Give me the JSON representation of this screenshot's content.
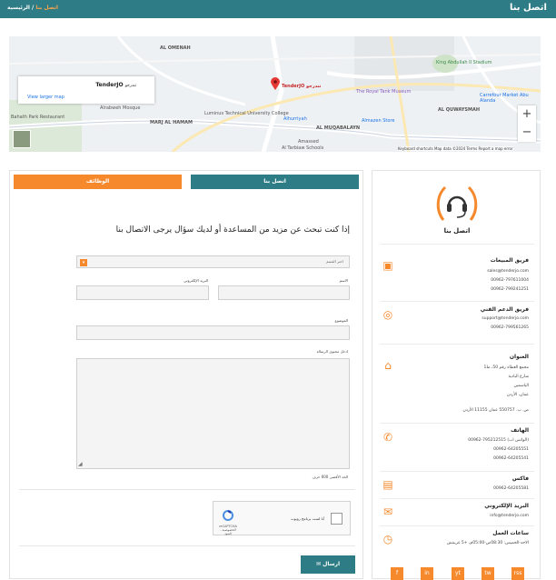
{
  "header": {
    "title": "اتصل بنا",
    "breadcrumb_home": "الرئيسية",
    "breadcrumb_sep": "/",
    "breadcrumb_current": "اتصل بنا"
  },
  "map": {
    "place_title": "TenderJO",
    "place_sub": "تندرجو",
    "larger_map": "View larger map",
    "marker_label": "TenderJO تندرجو",
    "labels": [
      "Luminus Technical University College",
      "Alrabweh Mosque",
      "MARJ AL HAMAM",
      "Bahath Park Restaurant",
      "AL OMENAH",
      "The Royal Tank Museum",
      "King Abdullah II Stadium",
      "Carrefour Market Abu Alanda",
      "AL QUWAYSMAH",
      "Almazen Store",
      "AL MUQABALAYN",
      "Al Tarbiaw Schools",
      "Alhurriyah",
      "Amassed"
    ],
    "google": "Google",
    "footer": "Keyboard shortcuts   Map data ©2024   Terms   Report a map error",
    "zoom_in": "+",
    "zoom_out": "−"
  },
  "tabs": {
    "contact": "اتصل بنا",
    "jobs": "الوظائف"
  },
  "form": {
    "intro": "إذا كنت تبحث عن مزيد من المساعدة أو لديك سؤال يرجى الاتصال بنا",
    "department_placeholder": "اختر القسم",
    "name_label": "الاسم",
    "email_label": "البريد الإلكتروني",
    "subject_label": "الموضوع",
    "message_label": "ادخل محتوى الرسالة",
    "char_limit": "الحد الأقصى 600 حرف",
    "captcha_text": "أنا لست برنامج روبوت",
    "captcha_brand": "reCAPTCHA",
    "captcha_terms": "الخصوصية - البنود",
    "send": "ارسال"
  },
  "side": {
    "title": "اتصل بنا",
    "sections": [
      {
        "icon": "briefcase-icon",
        "heading": "فريق المبيعات",
        "lines": [
          "sales@tenderjo.com",
          "00962-797611004",
          "00962-799241251"
        ]
      },
      {
        "icon": "lifebuoy-icon",
        "heading": "فريق الدعم الفني",
        "lines": [
          "support@tenderjo.com",
          "00962-799561265"
        ]
      },
      {
        "icon": "home-icon",
        "heading": "العنوان",
        "lines": [
          "مجمع العطاء رقم 50، ط1",
          "شارع البادية",
          "الياسمين",
          "عمان، الأردن",
          "ص. ب. 550757 عمان 11155 الأردن"
        ]
      },
      {
        "icon": "phone-icon",
        "heading": "الهاتف",
        "lines": [
          "00962-795212515 (الواتس اب)",
          "00962-64205551",
          "00962-64205541"
        ]
      },
      {
        "icon": "fax-icon",
        "heading": "فاكس",
        "lines": [
          "00962-64205581"
        ]
      },
      {
        "icon": "envelope-icon",
        "heading": "البريد الإلكتروني",
        "lines": [
          "info@tenderjo.com"
        ]
      },
      {
        "icon": "clock-icon",
        "heading": "ساعات العمل",
        "lines": [
          "الاحد-الخميس: 08:30ص-05:00م، +5 غرينتش"
        ]
      }
    ],
    "social": [
      "f",
      "in",
      "yt",
      "tw",
      "rss"
    ]
  },
  "colors": {
    "teal": "#2e7d86",
    "orange": "#f7892d"
  }
}
